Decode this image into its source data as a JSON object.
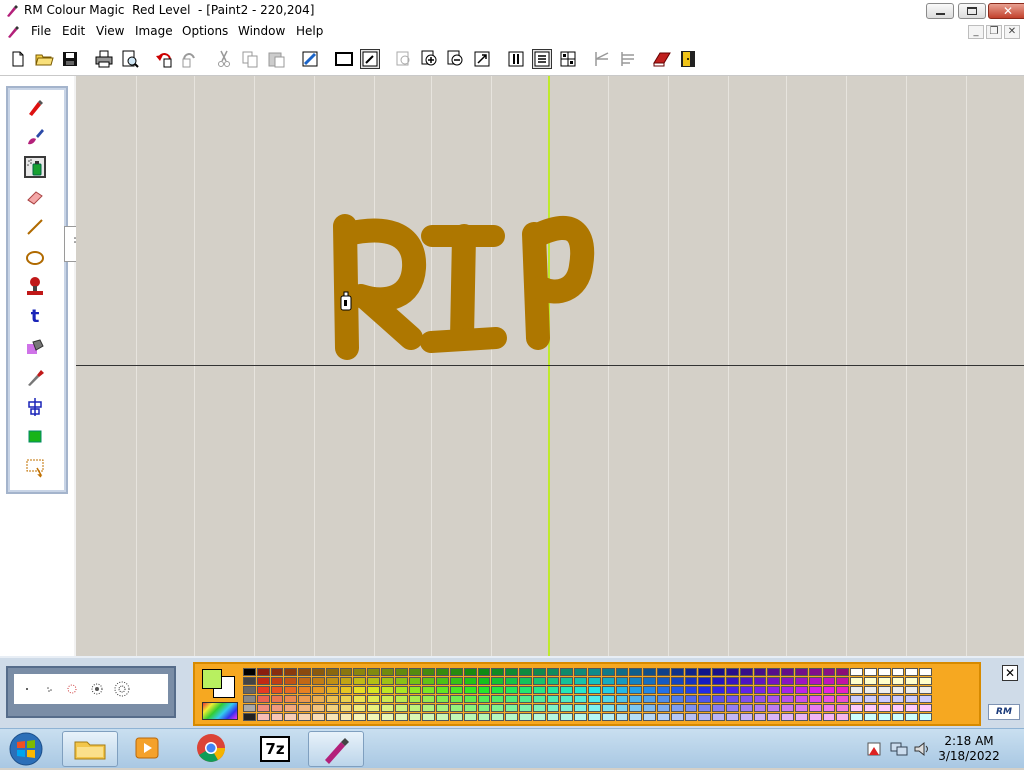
{
  "window": {
    "title": "RM Colour Magic  Red Level  - [Paint2 - 220,204]",
    "controls": {
      "minimize": "",
      "maximize": "",
      "close": "✕"
    }
  },
  "menubar": {
    "items": [
      "File",
      "Edit",
      "View",
      "Image",
      "Options",
      "Window",
      "Help"
    ]
  },
  "toolbar": {
    "buttons": [
      "new-file-icon",
      "open-folder-icon",
      "save-icon",
      "print-icon",
      "print-preview-icon",
      "undo-icon",
      "redo-icon",
      "cut-icon",
      "copy-icon",
      "paste-icon",
      "select-icon",
      "frame-icon",
      "edit-frame-icon",
      "zoom-copy-icon",
      "zoom-in-icon",
      "zoom-out-icon",
      "fit-icon",
      "columns-icon",
      "center-icon",
      "grid-icon",
      "arrow-icon",
      "arrow-right-icon",
      "book-icon",
      "exit-door-icon"
    ]
  },
  "toolbox": {
    "tools": [
      "pen-icon",
      "brush-icon",
      "spray-can-icon",
      "eraser-icon",
      "line-icon",
      "ellipse-icon",
      "stamp-icon",
      "text-icon",
      "fill-bucket-icon",
      "eyedropper-icon",
      "move-icon",
      "rectangle-icon",
      "select-rect-icon"
    ],
    "selected_tool": "spray-can-icon",
    "text_tool_glyph": "t",
    "flyout": [
      "spray-fine-icon",
      "spray-wide-icon"
    ]
  },
  "canvas": {
    "painted_text": "RIP",
    "paint_color": "#ae7700",
    "background_color": "#d4d0c8",
    "cursor": "spray-can-cursor-icon"
  },
  "colors": {
    "primary": "#b8f060",
    "secondary": "#ffffff",
    "palette_bg": "#f6a821"
  },
  "palette_close_label": "✕",
  "brand_logo": "RM",
  "taskbar": {
    "apps": [
      "windows-start-icon",
      "file-explorer-icon",
      "media-player-icon",
      "chrome-icon",
      "7zip-icon",
      "colour-magic-icon"
    ],
    "seven_zip_label": "7z",
    "time": "2:18 AM",
    "date": "3/18/2022"
  }
}
